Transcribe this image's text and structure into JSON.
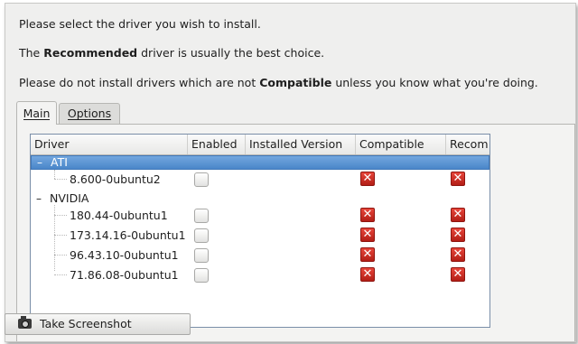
{
  "intro": {
    "line1": "Please select the driver you wish to install.",
    "line2_pre": "The ",
    "line2_bold": "Recommended",
    "line2_post": " driver is usually the best choice.",
    "line3_pre": "Please do not install drivers which are not ",
    "line3_bold": "Compatible",
    "line3_post": " unless you know what you're doing."
  },
  "tabs": [
    {
      "label": "Main",
      "active": true
    },
    {
      "label": "Options",
      "active": false
    }
  ],
  "table": {
    "columns": [
      "Driver",
      "Enabled",
      "Installed Version",
      "Compatible",
      "Recom"
    ],
    "groups": [
      {
        "label": "ATI",
        "expanded": true,
        "selected": true,
        "drivers": [
          {
            "name": "8.600-0ubuntu2",
            "enabled": false,
            "installed_version": "",
            "compatible": false,
            "recommended": false
          }
        ]
      },
      {
        "label": "NVIDIA",
        "expanded": true,
        "selected": false,
        "drivers": [
          {
            "name": "180.44-0ubuntu1",
            "enabled": false,
            "installed_version": "",
            "compatible": false,
            "recommended": false
          },
          {
            "name": "173.14.16-0ubuntu1",
            "enabled": false,
            "installed_version": "",
            "compatible": false,
            "recommended": false
          },
          {
            "name": "96.43.10-0ubuntu1",
            "enabled": false,
            "installed_version": "",
            "compatible": false,
            "recommended": false
          },
          {
            "name": "71.86.08-0ubuntu1",
            "enabled": false,
            "installed_version": "",
            "compatible": false,
            "recommended": false
          }
        ]
      }
    ],
    "expander_glyph": "–",
    "cross_glyph": "✕"
  },
  "taskbar": {
    "button_label": "Take Screenshot",
    "button_icon": "camera-icon"
  },
  "colors": {
    "selection": "#4a86c9",
    "cross": "#c4251c"
  }
}
